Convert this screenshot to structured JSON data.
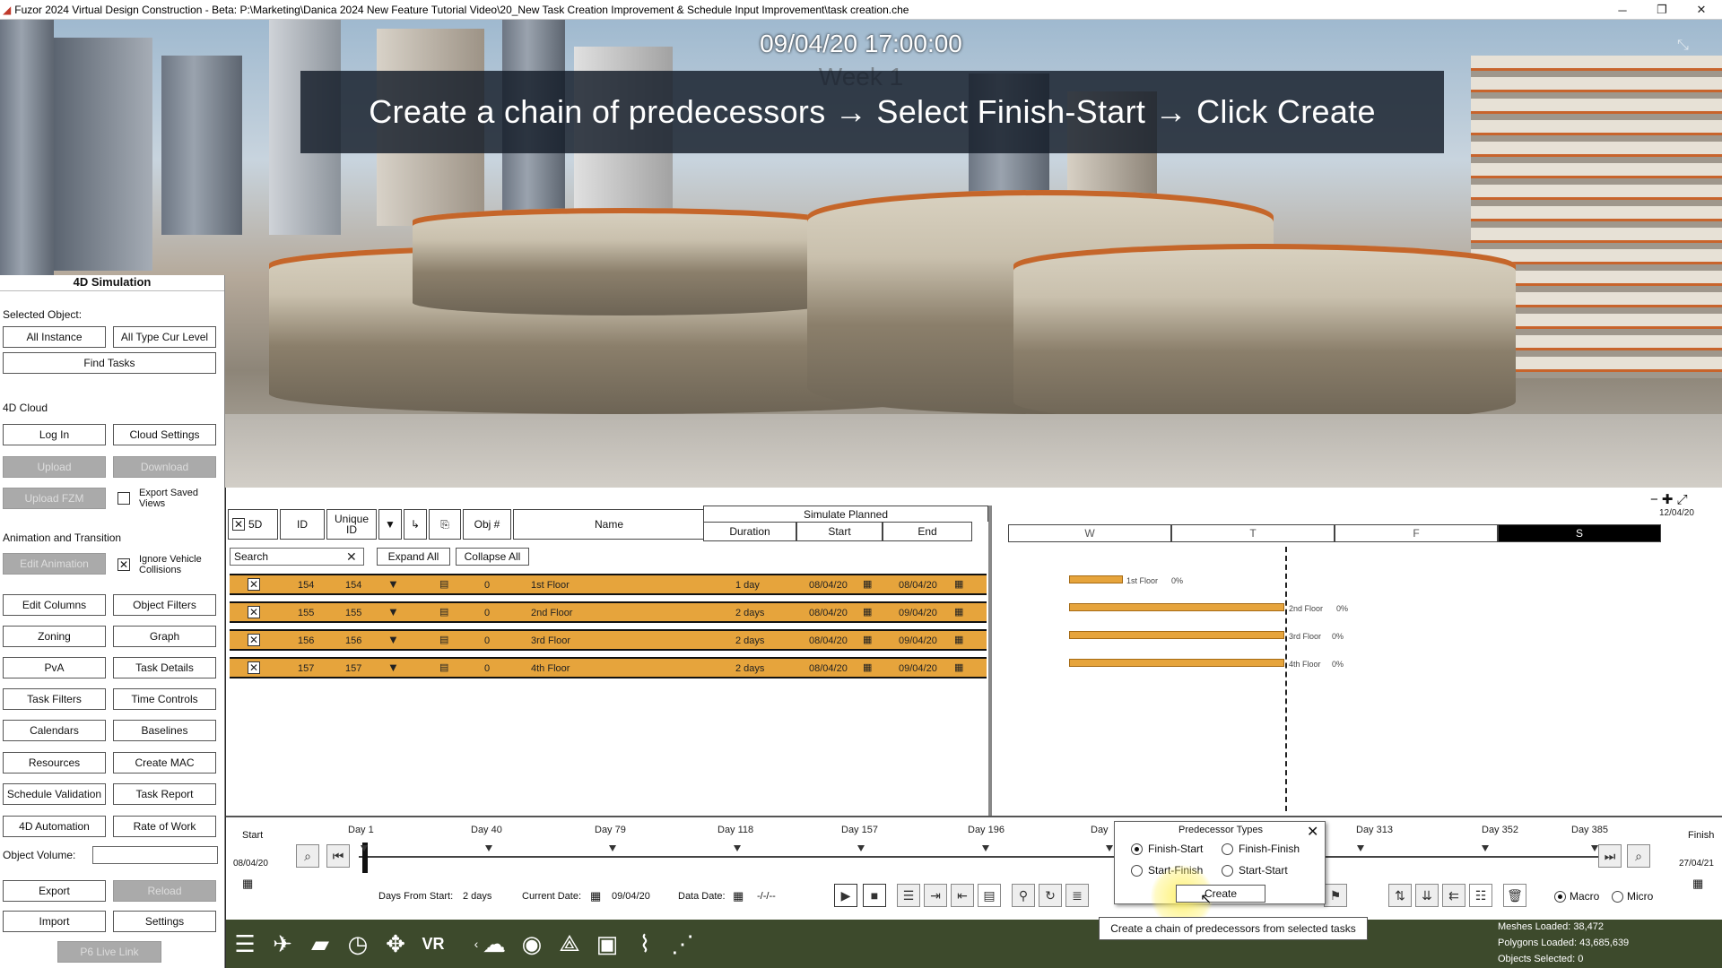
{
  "window": {
    "title": "Fuzor 2024 Virtual Design Construction - Beta: P:\\Marketing\\Danica 2024 New Feature Tutorial Video\\20_New Task Creation Improvement & Schedule Input Improvement\\task creation.che",
    "minimize": "─",
    "restore": "❐",
    "close": "✕"
  },
  "viewport": {
    "timestamp": "09/04/20 17:00:00",
    "week": "Week 1",
    "banner": "Create a chain of predecessors → Select Finish-Start → Click Create"
  },
  "left_panel": {
    "title": "4D Simulation",
    "selected_object_label": "Selected Object:",
    "all_instance": "All Instance",
    "all_type_cur_level": "All Type Cur Level",
    "find_tasks": "Find Tasks",
    "cloud_label": "4D Cloud",
    "log_in": "Log In",
    "cloud_settings": "Cloud Settings",
    "upload": "Upload",
    "download": "Download",
    "upload_fzm": "Upload FZM",
    "export_saved_views": "Export Saved Views",
    "anim_label": "Animation and Transition",
    "edit_animation": "Edit Animation",
    "ignore_vehicle": "Ignore Vehicle Collisions",
    "buttons": [
      [
        "Edit Columns",
        "Object Filters"
      ],
      [
        "Zoning",
        "Graph"
      ],
      [
        "PvA",
        "Task Details"
      ],
      [
        "Task Filters",
        "Time Controls"
      ],
      [
        "Calendars",
        "Baselines"
      ],
      [
        "Resources",
        "Create MAC"
      ],
      [
        "Schedule Validation",
        "Task Report"
      ],
      [
        "4D Automation",
        "Rate of Work"
      ]
    ],
    "object_volume": "Object Volume:",
    "export": "Export",
    "reload": "Reload",
    "import": "Import",
    "settings": "Settings",
    "p6_live_link": "P6 Live Link"
  },
  "schedule": {
    "col_5d": "5D",
    "col_id": "ID",
    "col_unique_id": "Unique ID",
    "col_obj": "Obj #",
    "col_name": "Name",
    "group_header": "Simulate Planned",
    "col_duration": "Duration",
    "col_start": "Start",
    "col_end": "End",
    "search_placeholder": "Search",
    "expand_all": "Expand All",
    "collapse_all": "Collapse All",
    "rows": [
      {
        "id": "154",
        "uid": "154",
        "obj": "0",
        "name": "1st Floor",
        "duration": "1 day",
        "start": "08/04/20",
        "end": "08/04/20"
      },
      {
        "id": "155",
        "uid": "155",
        "obj": "0",
        "name": "2nd Floor",
        "duration": "2 days",
        "start": "08/04/20",
        "end": "09/04/20"
      },
      {
        "id": "156",
        "uid": "156",
        "obj": "0",
        "name": "3rd Floor",
        "duration": "2 days",
        "start": "08/04/20",
        "end": "09/04/20"
      },
      {
        "id": "157",
        "uid": "157",
        "obj": "0",
        "name": "4th Floor",
        "duration": "2 days",
        "start": "08/04/20",
        "end": "09/04/20"
      }
    ]
  },
  "gantt": {
    "date": "12/04/20",
    "days": [
      "W",
      "T",
      "F",
      "S"
    ],
    "bars": [
      {
        "label": "1st Floor",
        "pct": "0%"
      },
      {
        "label": "2nd Floor",
        "pct": "0%"
      },
      {
        "label": "3rd Floor",
        "pct": "0%"
      },
      {
        "label": "4th Floor",
        "pct": "0%"
      }
    ]
  },
  "timeline": {
    "start_label": "Start",
    "start_date": "08/04/20",
    "finish_label": "Finish",
    "finish_date": "27/04/21",
    "days": [
      "Day 1",
      "Day 40",
      "Day 79",
      "Day 118",
      "Day 157",
      "Day 196",
      "Day",
      "Day 313",
      "Day 352",
      "Day 385"
    ],
    "days_from_start_label": "Days From Start:",
    "days_from_start": "2 days",
    "current_date_label": "Current Date:",
    "current_date": "09/04/20",
    "data_date_label": "Data Date:",
    "data_date": "-/-/--",
    "macro": "Macro",
    "micro": "Micro"
  },
  "popup": {
    "title": "Predecessor Types",
    "finish_start": "Finish-Start",
    "finish_finish": "Finish-Finish",
    "start_finish": "Start-Finish",
    "start_start": "Start-Start",
    "create": "Create",
    "tooltip": "Create a chain of predecessors from selected tasks"
  },
  "stats": {
    "meshes": "Meshes Loaded: 38,472",
    "polygons": "Polygons Loaded: 43,685,639",
    "objects": "Objects Selected: 0"
  }
}
